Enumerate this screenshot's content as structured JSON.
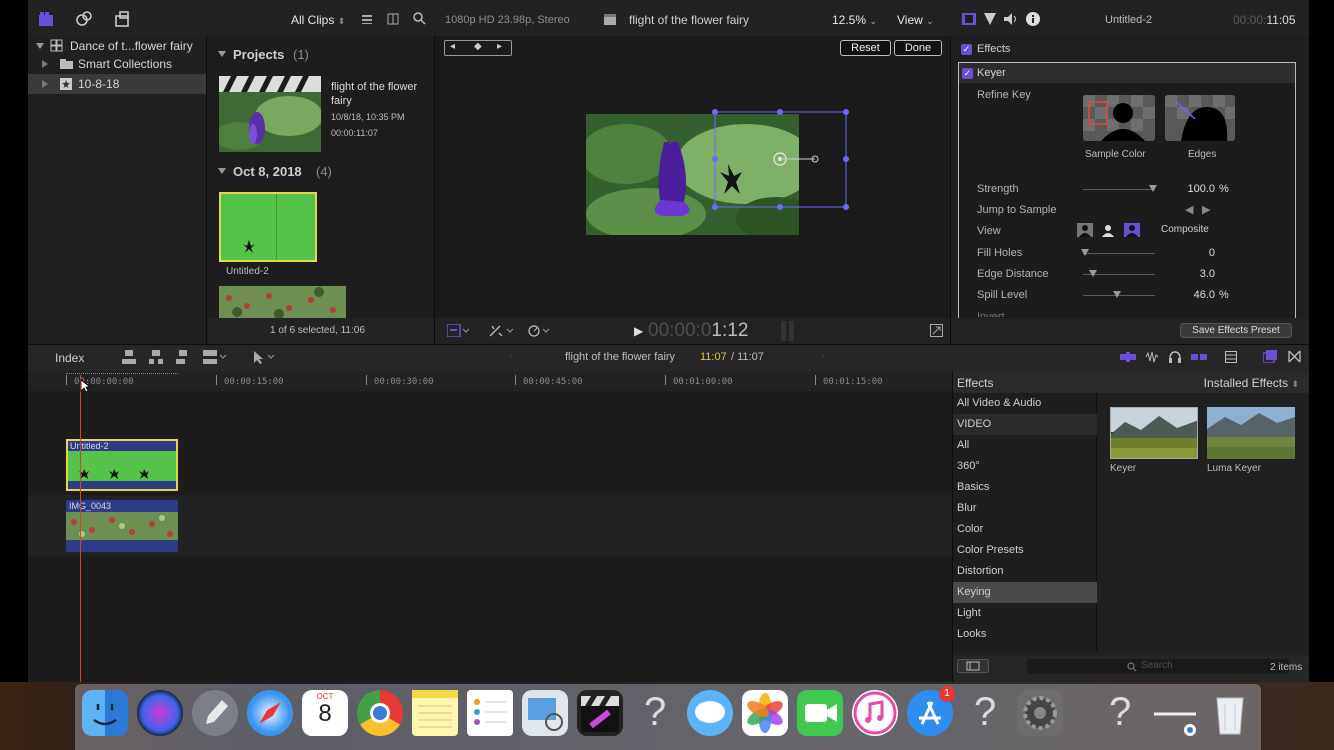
{
  "browser": {
    "filter_label": "All Clips",
    "library_name": "Dance of t...flower fairy",
    "smart_collections": "Smart Collections",
    "event_name": "10-8-18",
    "projects_header": "Projects",
    "projects_count": "(1)",
    "project": {
      "title": "flight of the flower fairy",
      "date": "10/8/18, 10:35 PM",
      "duration": "00:00:11:07"
    },
    "event_header": "Oct 8, 2018",
    "event_count": "(4)",
    "clip_label": "Untitled-2",
    "status": "1 of 6 selected, 11:06"
  },
  "viewer": {
    "format": "1080p HD 23.98p, Stereo",
    "title": "flight of the flower fairy",
    "zoom": "12.5%",
    "view_menu": "View",
    "reset_label": "Reset",
    "done_label": "Done",
    "timecode_dim": "00:00:0",
    "timecode_bright": "1:12"
  },
  "inspector": {
    "clip_name": "Untitled-2",
    "duration_dim": "00:00:",
    "duration": "11:05",
    "effects_label": "Effects",
    "keyer_label": "Keyer",
    "refine_key": "Refine Key",
    "sample_color": "Sample Color",
    "edges": "Edges",
    "params": [
      {
        "label": "Strength",
        "value": "100.0",
        "unit": "%"
      },
      {
        "label": "Jump to Sample",
        "value": "",
        "unit": ""
      },
      {
        "label": "View",
        "value": "Composite",
        "unit": ""
      },
      {
        "label": "Fill Holes",
        "value": "0",
        "unit": ""
      },
      {
        "label": "Edge Distance",
        "value": "3.0",
        "unit": ""
      },
      {
        "label": "Spill Level",
        "value": "46.0",
        "unit": "%"
      }
    ],
    "cut_label": "Invert",
    "save_preset": "Save Effects Preset"
  },
  "timeline": {
    "index_label": "Index",
    "project_name": "flight of the flower fairy",
    "position": "11:07",
    "total": "/ 11:07",
    "ruler": [
      "00:00:00:00",
      "00:00:15:00",
      "00:00:30:00",
      "00:00:45:00",
      "00:01:00:00",
      "00:01:15:00"
    ],
    "clip_top": "Untitled-2",
    "clip_bottom": "IMG_0043"
  },
  "effects_browser": {
    "header": "Effects",
    "installed": "Installed Effects",
    "categories": [
      "All Video & Audio",
      "VIDEO",
      "All",
      "360°",
      "Basics",
      "Blur",
      "Color",
      "Color Presets",
      "Distortion",
      "Keying",
      "Light",
      "Looks"
    ],
    "selected_category": "Keying",
    "effects": [
      "Keyer",
      "Luma Keyer"
    ],
    "search_placeholder": "Search",
    "count": "2 items"
  },
  "dock": {
    "calendar_month": "OCT",
    "calendar_day": "8",
    "appstore_badge": "1"
  },
  "colors": {
    "accent": "#6b4fd8",
    "selection_yellow": "#e8d64a",
    "timecode_yellow": "#e6c24a",
    "playhead": "#d0482a",
    "clip_green": "#55c24a"
  }
}
